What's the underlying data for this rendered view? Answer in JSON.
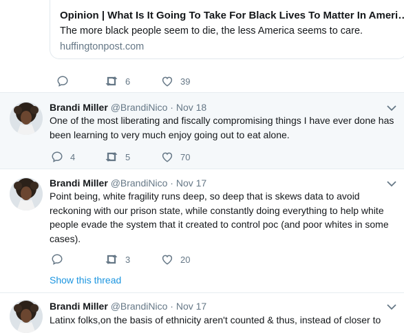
{
  "card": {
    "title": "Opinion | What Is It Going To Take For Black Lives To Matter In Ameri…",
    "description": "The more black people seem to die, the less America seems to care.",
    "domain": "huffingtonpost.com"
  },
  "card_actions": {
    "retweets": "6",
    "likes": "39"
  },
  "tweets": [
    {
      "name": "Brandi Miller",
      "handle": "@BrandiNico",
      "dot": "·",
      "date": "Nov 18",
      "text": "One of the most liberating and fiscally compromising things I have ever done has been learning to very much enjoy going out to eat alone.",
      "replies": "4",
      "retweets": "5",
      "likes": "70"
    },
    {
      "name": "Brandi Miller",
      "handle": "@BrandiNico",
      "dot": "·",
      "date": "Nov 17",
      "text": "Point being, white fragility runs deep, so deep that is skews data to avoid reckoning with our prison state, while constantly doing everything to help white people evade the system that it created to control poc (and poor whites in some cases).",
      "replies": "",
      "retweets": "3",
      "likes": "20",
      "show_thread": "Show this thread"
    },
    {
      "name": "Brandi Miller",
      "handle": "@BrandiNico",
      "dot": "·",
      "date": "Nov 17",
      "text": "Latinx folks,on the basis of ethnicity aren't counted & thus, instead of closer to"
    }
  ],
  "icons": {
    "reply": "reply-icon",
    "retweet": "retweet-icon",
    "like": "heart-icon",
    "more": "chevron-down-icon"
  },
  "colors": {
    "text": "#14171a",
    "muted": "#657786",
    "link": "#1b95e0",
    "highlight_bg": "#f5f8fa",
    "divider": "#e6ecf0"
  }
}
